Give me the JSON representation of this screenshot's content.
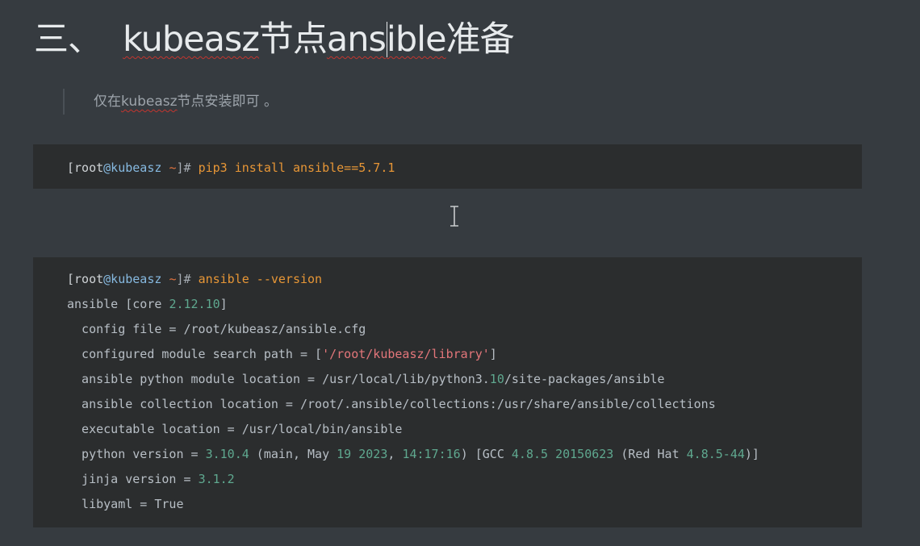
{
  "heading": {
    "number": "三、",
    "w1": "kubeasz",
    "w2": "节点",
    "w3a": "ans",
    "w3b": "ible",
    "w4": "准备"
  },
  "note": {
    "pre": "仅在",
    "word": "kubeasz",
    "post": "节点安装即可 。"
  },
  "block1": {
    "user": "[root",
    "host": "@kubeasz",
    "tilde": "~",
    "close": "]#",
    "cmd": "pip3 install ansible==5.7.1"
  },
  "block2": {
    "prompt_user": "[root",
    "prompt_host": "@kubeasz",
    "prompt_tilde": "~",
    "prompt_close": "]#",
    "cmd": "ansible --version",
    "l2a": "ansible [core ",
    "l2b": "2.12.10",
    "l2c": "]",
    "l3": "  config file = /root/kubeasz/ansible.cfg",
    "l4a": "  configured module search path = [",
    "l4b": "'/root/kubeasz/library'",
    "l4c": "]",
    "l5a": "  ansible python module location = /usr/local/lib/python3.",
    "l5b": "10",
    "l5c": "/site-packages/ansible",
    "l6": "  ansible collection location = /root/.ansible/collections:/usr/share/ansible/collections",
    "l7": "  executable location = /usr/local/bin/ansible",
    "l8a": "  python version = ",
    "l8b": "3.10.4",
    "l8c": " (main, May ",
    "l8d": "19 2023",
    "l8e": ", ",
    "l8f": "14:17:16",
    "l8g": ") [GCC ",
    "l8h": "4.8.5 20150623",
    "l8i": " (Red Hat ",
    "l8j": "4.8.5-44",
    "l8k": ")]",
    "l9a": "  jinja version = ",
    "l9b": "3.1.2",
    "l10": "  libyaml = True"
  },
  "colors": {
    "background": "#363b40",
    "code_background": "#2b2d2e",
    "command": "#e79636",
    "number": "#5fa88f",
    "string": "#e3767a",
    "host": "#86b9e0",
    "spellcheck": "#c3352f"
  },
  "icons": {
    "cursor": "text-cursor-icon"
  }
}
